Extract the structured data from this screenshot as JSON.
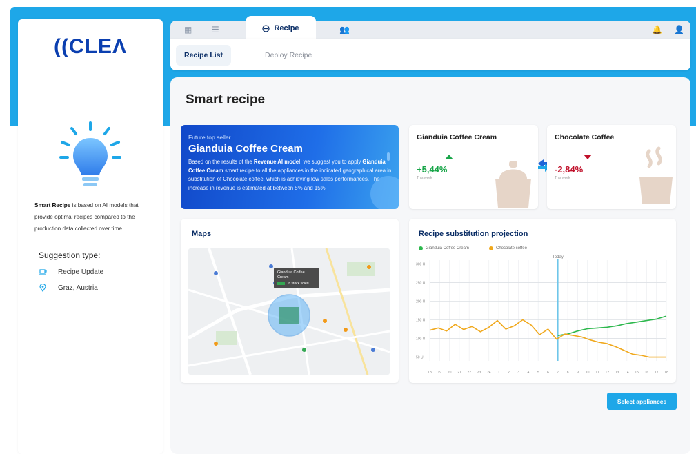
{
  "app": {
    "logo_text": "((CLEΛ"
  },
  "sidebar": {
    "description_bold": "Smart Recipe",
    "description_rest": " is based on AI models that provide optimal recipes compared to the production data collected over time",
    "suggestion_title": "Suggestion type:",
    "suggestions": [
      {
        "icon": "coffee-cup-icon",
        "label": "Recipe Update"
      },
      {
        "icon": "location-pin-icon",
        "label": "Graz, Austria"
      }
    ]
  },
  "nav": {
    "active_tab": "Recipe",
    "subtabs": [
      "Recipe List",
      "Deploy Recipe"
    ]
  },
  "page": {
    "title": "Smart recipe"
  },
  "hero": {
    "kicker": "Future top seller",
    "title": "Gianduia Coffee Cream",
    "body_1": "Based on the results of the ",
    "body_2": "Revenue AI model",
    "body_3": ", we suggest you to apply ",
    "body_4": "Gianduia Coffee Cream",
    "body_5": " smart recipe to all the appliances in the indicated geographical area in substitution of Chocolate coffee, which is achieving low sales performances. The increase in revenue is estimated at between 5% and 15%."
  },
  "stats": [
    {
      "title": "Gianduia Coffee Cream",
      "value": "+5,44%",
      "sub": "This week",
      "color": "#1aa64a"
    },
    {
      "title": "Chocolate Coffee",
      "value": "-2,84%",
      "sub": "This week",
      "color": "#c0102a"
    }
  ],
  "maps": {
    "title": "Maps",
    "popup_title": "Gianduia Coffee Cream",
    "popup_status": "In stock soled"
  },
  "projection": {
    "title": "Recipe substitution projection",
    "today_label": "Today"
  },
  "chart_data": {
    "type": "line",
    "title": "Recipe substitution projection",
    "x": [
      "18",
      "19",
      "20",
      "21",
      "22",
      "23",
      "24",
      "1",
      "2",
      "3",
      "4",
      "5",
      "6",
      "7",
      "8",
      "9",
      "10",
      "11",
      "12",
      "13",
      "14",
      "15",
      "16",
      "17",
      "18"
    ],
    "yticks": [
      "300 U",
      "250 U",
      "200 U",
      "150 U",
      "100 U",
      "50 U"
    ],
    "ylim": [
      40,
      310
    ],
    "today_index": 13,
    "series": [
      {
        "name": "Gianduia Coffee Cream",
        "color": "#2db84d",
        "start_index": 13,
        "values": [
          108,
          112,
          120,
          126,
          128,
          130,
          134,
          140,
          144,
          148,
          152,
          160
        ]
      },
      {
        "name": "Chocolate coffee",
        "color": "#f0a81c",
        "start_index": 0,
        "values": [
          122,
          128,
          120,
          138,
          124,
          132,
          118,
          130,
          148,
          125,
          134,
          150,
          136,
          110,
          125,
          98,
          112,
          108,
          104,
          96,
          90,
          86,
          78,
          68,
          58,
          55,
          50,
          50,
          50
        ]
      }
    ]
  },
  "actions": {
    "select_label": "Select appliances"
  }
}
